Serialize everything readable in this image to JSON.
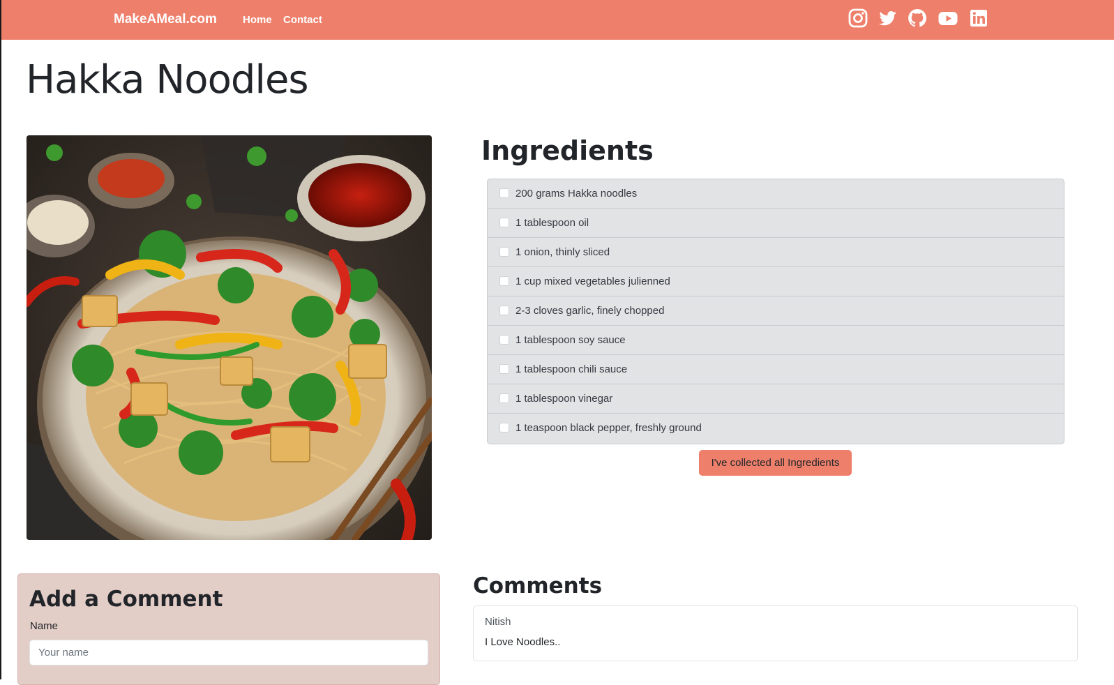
{
  "navbar": {
    "brand": "MakeAMeal.com",
    "links": [
      {
        "label": "Home"
      },
      {
        "label": "Contact"
      }
    ],
    "social_icons": [
      "instagram-icon",
      "twitter-icon",
      "github-icon",
      "youtube-icon",
      "linkedin-icon"
    ],
    "background_color": "#ee806b"
  },
  "recipe": {
    "title": "Hakka Noodles"
  },
  "ingredients": {
    "title": "Ingredients",
    "items": [
      {
        "label": "200 grams Hakka noodles",
        "checked": false
      },
      {
        "label": "1 tablespoon oil",
        "checked": false
      },
      {
        "label": "1 onion, thinly sliced",
        "checked": false
      },
      {
        "label": "1 cup mixed vegetables julienned",
        "checked": false
      },
      {
        "label": "2-3 cloves garlic, finely chopped",
        "checked": false
      },
      {
        "label": "1 tablespoon soy sauce",
        "checked": false
      },
      {
        "label": "1 tablespoon chili sauce",
        "checked": false
      },
      {
        "label": "1 tablespoon vinegar",
        "checked": false
      },
      {
        "label": "1 teaspoon black pepper, freshly ground",
        "checked": false
      }
    ],
    "collect_button": "I've collected all Ingredients"
  },
  "comment_form": {
    "title": "Add a Comment",
    "name_label": "Name",
    "name_placeholder": "Your name",
    "name_value": ""
  },
  "comments": {
    "title": "Comments",
    "items": [
      {
        "author": "Nitish",
        "text": "I Love Noodles.."
      }
    ]
  },
  "colors": {
    "accent": "#ee806b",
    "form_background": "#e3cdc7",
    "list_background": "#e2e3e5"
  }
}
